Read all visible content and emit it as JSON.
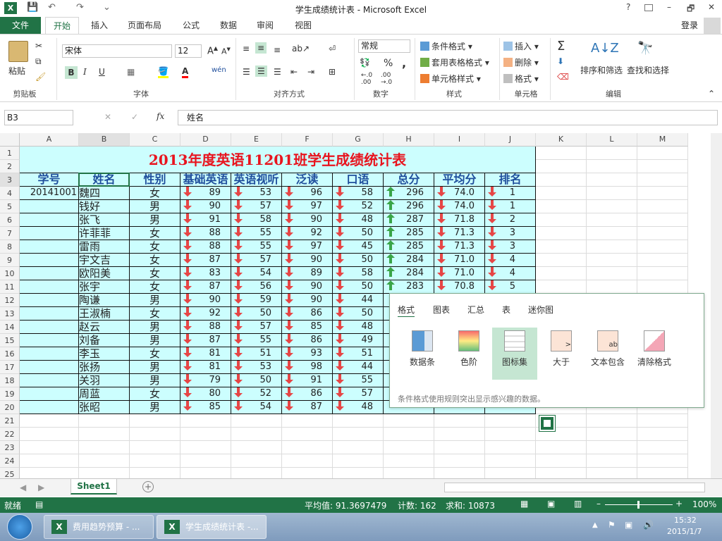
{
  "window": {
    "title": "学生成绩统计表 - Microsoft Excel",
    "help": "?",
    "minimize": "–",
    "restore": "🗗",
    "close": "✕"
  },
  "quick_access": [
    "💾",
    "↶",
    "↷",
    "⌄"
  ],
  "tabs": [
    {
      "label": "文件",
      "file": true
    },
    {
      "label": "开始",
      "active": true
    },
    {
      "label": "插入"
    },
    {
      "label": "页面布局"
    },
    {
      "label": "公式"
    },
    {
      "label": "数据"
    },
    {
      "label": "审阅"
    },
    {
      "label": "视图"
    }
  ],
  "login": "登录",
  "ribbon": {
    "clipboard": {
      "label": "剪贴板",
      "paste": "粘贴"
    },
    "font": {
      "label": "字体",
      "name": "宋体",
      "size": "12",
      "bold": "B",
      "italic": "I",
      "underline": "U",
      "wen": "wén"
    },
    "align": {
      "label": "对齐方式"
    },
    "number": {
      "label": "数字",
      "format": "常规",
      "percent": "%",
      "comma": ","
    },
    "styles": {
      "label": "样式",
      "cond": "条件格式",
      "table": "套用表格格式",
      "cell": "单元格样式"
    },
    "cells": {
      "label": "单元格",
      "insert": "插入",
      "delete": "删除",
      "format": "格式"
    },
    "edit": {
      "label": "编辑",
      "sum": "Σ",
      "sort": "排序和筛选",
      "find": "查找和选择"
    }
  },
  "formula_bar": {
    "name_box": "B3",
    "fx": "fx",
    "value": "姓名"
  },
  "columns": [
    "A",
    "B",
    "C",
    "D",
    "E",
    "F",
    "G",
    "H",
    "I",
    "J",
    "K",
    "L",
    "M"
  ],
  "rows": [
    "1",
    "2",
    "3",
    "4",
    "5",
    "6",
    "7",
    "8",
    "9",
    "10",
    "11",
    "12",
    "13",
    "14",
    "15",
    "16",
    "17",
    "18",
    "19",
    "20",
    "21",
    "22",
    "23",
    "24",
    "25"
  ],
  "sheet": {
    "title": "2013年度英语11201班学生成绩统计表",
    "headers": [
      "学号",
      "姓名",
      "性别",
      "基础英语",
      "英语视听",
      "泛读",
      "口语",
      "总分",
      "平均分",
      "排名"
    ],
    "data": [
      [
        "20141001",
        "魏四",
        "女",
        "89",
        "53",
        "96",
        "58",
        "296",
        "74.0",
        "1"
      ],
      [
        "",
        "钱好",
        "男",
        "90",
        "57",
        "97",
        "52",
        "296",
        "74.0",
        "1"
      ],
      [
        "",
        "张飞",
        "男",
        "91",
        "58",
        "90",
        "48",
        "287",
        "71.8",
        "2"
      ],
      [
        "",
        "许菲菲",
        "女",
        "88",
        "55",
        "92",
        "50",
        "285",
        "71.3",
        "3"
      ],
      [
        "",
        "雷雨",
        "女",
        "88",
        "55",
        "97",
        "45",
        "285",
        "71.3",
        "3"
      ],
      [
        "",
        "宇文吉",
        "女",
        "87",
        "57",
        "90",
        "50",
        "284",
        "71.0",
        "4"
      ],
      [
        "",
        "欧阳美",
        "女",
        "83",
        "54",
        "89",
        "58",
        "284",
        "71.0",
        "4"
      ],
      [
        "",
        "张宇",
        "女",
        "87",
        "56",
        "90",
        "50",
        "283",
        "70.8",
        "5"
      ],
      [
        "",
        "陶谦",
        "男",
        "90",
        "59",
        "90",
        "44",
        "",
        "",
        ""
      ],
      [
        "",
        "王淑楠",
        "女",
        "92",
        "50",
        "86",
        "50",
        "",
        "",
        ""
      ],
      [
        "",
        "赵云",
        "男",
        "88",
        "57",
        "85",
        "48",
        "",
        "",
        ""
      ],
      [
        "",
        "刘备",
        "男",
        "87",
        "55",
        "86",
        "49",
        "",
        "",
        ""
      ],
      [
        "",
        "李玉",
        "女",
        "81",
        "51",
        "93",
        "51",
        "",
        "",
        ""
      ],
      [
        "",
        "张扬",
        "男",
        "81",
        "53",
        "98",
        "44",
        "",
        "",
        ""
      ],
      [
        "",
        "关羽",
        "男",
        "79",
        "50",
        "91",
        "55",
        "",
        "",
        ""
      ],
      [
        "",
        "周蓝",
        "女",
        "80",
        "52",
        "86",
        "57",
        "",
        "",
        ""
      ],
      [
        "",
        "张昭",
        "男",
        "85",
        "54",
        "87",
        "48",
        "",
        "",
        ""
      ]
    ]
  },
  "quick_analysis": {
    "tabs": [
      "格式",
      "图表",
      "汇总",
      "表",
      "迷你图"
    ],
    "items": [
      "数据条",
      "色阶",
      "图标集",
      "大于",
      "文本包含",
      "清除格式"
    ],
    "description": "条件格式使用规则突出显示感兴趣的数据。"
  },
  "sheet_tab": "Sheet1",
  "status": {
    "ready": "就绪",
    "avg": "平均值: 91.3697479",
    "count": "计数: 162",
    "sum": "求和: 10873",
    "zoom": "100%"
  },
  "taskbar": {
    "items": [
      "费用趋势预算 - ...",
      "学生成绩统计表 -..."
    ],
    "time": "15:32",
    "date": "2015/1/7"
  },
  "colors": {
    "excel_green": "#217346",
    "cell_bg": "#ccfefe",
    "title_red": "#e8141e",
    "header_blue": "#1f4e9c",
    "arrow_red": "#e64646",
    "arrow_green": "#3aa548"
  }
}
